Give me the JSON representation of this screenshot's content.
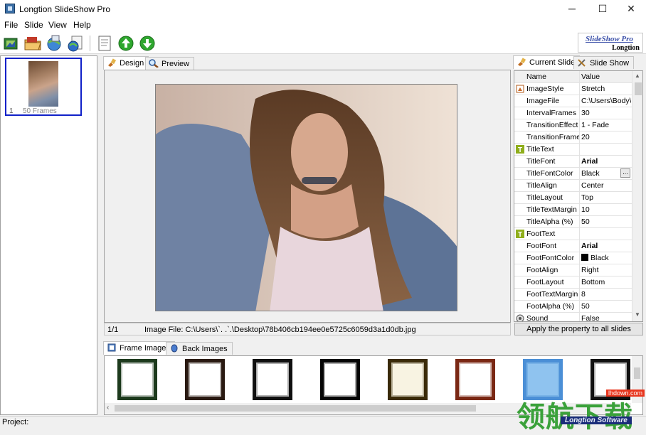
{
  "window": {
    "title": "Longtion SlideShow Pro",
    "minimize": "─",
    "maximize": "☐",
    "close": "✕"
  },
  "menu": [
    "File",
    "Slide",
    "View",
    "Help"
  ],
  "logo": {
    "line1": "SlideShow Pro",
    "line2": "Longtion"
  },
  "slides": [
    {
      "number": "1",
      "frames": "50 Frames"
    }
  ],
  "center_tabs": {
    "design": "Design",
    "preview": "Preview"
  },
  "status_line": {
    "position": "1/1",
    "image_file": "Image File: C:\\Users\\`. .`.\\Desktop\\78b406cb194ee0e5725c6059d3a1d0db.jpg"
  },
  "right_tabs": {
    "current_slide": "Current Slide",
    "slide_show": "Slide Show"
  },
  "property_grid": {
    "col_name": "Name",
    "col_value": "Value",
    "rows": [
      {
        "name": "ImageStyle",
        "value": "Stretch",
        "icon": "image-style-icon"
      },
      {
        "name": "ImageFile",
        "value": "C:\\Users\\Body\\D"
      },
      {
        "name": "IntervalFrames",
        "value": "30"
      },
      {
        "name": "TransitionEffect",
        "value": "1 - Fade"
      },
      {
        "name": "TransitionFrames",
        "value": "20"
      },
      {
        "name": "TitleText",
        "value": "",
        "icon": "text-icon"
      },
      {
        "name": "TitleFont",
        "value": "Arial",
        "bold": true
      },
      {
        "name": "TitleFontColor",
        "value": "Black",
        "ellipsis": "..."
      },
      {
        "name": "TitleAlign",
        "value": "Center"
      },
      {
        "name": "TitleLayout",
        "value": "Top"
      },
      {
        "name": "TitleTextMargin",
        "value": "10"
      },
      {
        "name": "TitleAlpha (%)",
        "value": "50"
      },
      {
        "name": "FootText",
        "value": "",
        "icon": "text-icon"
      },
      {
        "name": "FootFont",
        "value": "Arial",
        "bold": true
      },
      {
        "name": "FootFontColor",
        "value": "Black",
        "swatch": "#000000"
      },
      {
        "name": "FootAlign",
        "value": "Right"
      },
      {
        "name": "FootLayout",
        "value": "Bottom"
      },
      {
        "name": "FootTextMargin",
        "value": "8"
      },
      {
        "name": "FootAlpha (%)",
        "value": "50"
      },
      {
        "name": "Sound",
        "value": "False",
        "icon": "sound-icon"
      }
    ]
  },
  "apply_button": "Apply the property to all slides",
  "bottom_tabs": {
    "frame_images": "Frame Images",
    "back_images": "Back Images"
  },
  "frames": [
    {
      "border": "#1d3a1d",
      "inner": "#ffffff"
    },
    {
      "border": "#2a1a12",
      "inner": "#ffffff"
    },
    {
      "border": "#101010",
      "inner": "#ffffff"
    },
    {
      "border": "#050505",
      "inner": "#ffffff"
    },
    {
      "border": "#3a2a08",
      "inner": "#f8f3e2"
    },
    {
      "border": "#7a2814",
      "inner": "#ffffff"
    },
    {
      "border": "#4b8fd6",
      "inner": "#8fc3ef"
    },
    {
      "border": "#111111",
      "inner": "#ffffff"
    }
  ],
  "status_bar": {
    "project": "Project:"
  },
  "watermark": {
    "site": "lhdown.com",
    "chinese": "领航下载",
    "sub": "Longtion Software"
  },
  "colors": {
    "selection": "#1020c8",
    "accent_green": "#3aa13a"
  }
}
